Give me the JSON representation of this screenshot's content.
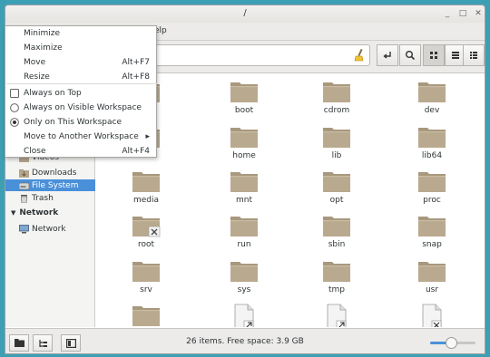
{
  "window": {
    "title": "/"
  },
  "titlebar_buttons": {
    "minimize": "_",
    "maximize": "□",
    "close": "✕"
  },
  "menubar": {
    "visible_fragment": "elp"
  },
  "location": {
    "value": ""
  },
  "context_menu": {
    "items": [
      {
        "label": "Minimize",
        "accel": ""
      },
      {
        "label": "Maximize",
        "accel": ""
      },
      {
        "label": "Move",
        "accel": "Alt+F7"
      },
      {
        "label": "Resize",
        "accel": "Alt+F8"
      },
      {
        "label": "Always on Top",
        "accel": "",
        "mark": "checkbox",
        "checked": false
      },
      {
        "label": "Always on Visible Workspace",
        "accel": "",
        "mark": "radio",
        "checked": false
      },
      {
        "label": "Only on This Workspace",
        "accel": "",
        "mark": "radio",
        "checked": true
      },
      {
        "label": "Move to Another Workspace",
        "accel": "",
        "submenu_arrow": "▸"
      },
      {
        "label": "Close",
        "accel": "Alt+F4"
      }
    ]
  },
  "sidebar": {
    "items": [
      {
        "label": "Videos",
        "icon": "video-folder-icon"
      },
      {
        "label": "Downloads",
        "icon": "downloads-folder-icon"
      },
      {
        "label": "File System",
        "icon": "drive-icon",
        "selected": true
      },
      {
        "label": "Trash",
        "icon": "trash-icon"
      }
    ],
    "network_header": "Network",
    "network_items": [
      {
        "label": "Network",
        "icon": "network-icon"
      }
    ]
  },
  "files": [
    {
      "name": "",
      "kind": "folder"
    },
    {
      "name": "boot",
      "kind": "folder"
    },
    {
      "name": "cdrom",
      "kind": "folder"
    },
    {
      "name": "dev",
      "kind": "folder"
    },
    {
      "name": "",
      "kind": "folder"
    },
    {
      "name": "home",
      "kind": "folder"
    },
    {
      "name": "lib",
      "kind": "folder"
    },
    {
      "name": "lib64",
      "kind": "folder"
    },
    {
      "name": "media",
      "kind": "folder"
    },
    {
      "name": "mnt",
      "kind": "folder"
    },
    {
      "name": "opt",
      "kind": "folder"
    },
    {
      "name": "proc",
      "kind": "folder"
    },
    {
      "name": "root",
      "kind": "folder",
      "emblem": "locked"
    },
    {
      "name": "run",
      "kind": "folder"
    },
    {
      "name": "sbin",
      "kind": "folder"
    },
    {
      "name": "snap",
      "kind": "folder"
    },
    {
      "name": "srv",
      "kind": "folder"
    },
    {
      "name": "sys",
      "kind": "folder"
    },
    {
      "name": "tmp",
      "kind": "folder"
    },
    {
      "name": "usr",
      "kind": "folder"
    },
    {
      "name": "",
      "kind": "folder"
    },
    {
      "name": "",
      "kind": "file-link"
    },
    {
      "name": "",
      "kind": "file-link"
    },
    {
      "name": "",
      "kind": "file-locked"
    }
  ],
  "status": {
    "text": "26 items. Free space: 3.9 GB",
    "zoom_level": 0.45
  },
  "colors": {
    "accent": "#4a90d9",
    "folder": "#b5a58c",
    "desktop": "#3d9fb3"
  }
}
